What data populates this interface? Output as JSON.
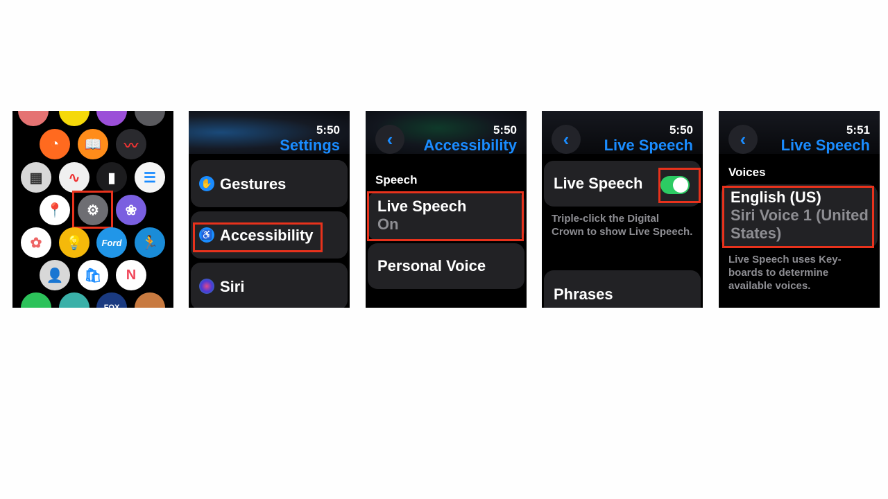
{
  "panel1": {
    "apps": [
      {
        "name": "settings-app",
        "glyph": "⚙",
        "color": "#6e6e73"
      }
    ]
  },
  "panel2": {
    "time": "5:50",
    "title": "Settings",
    "items": [
      {
        "label": "Gestures",
        "icon": "gestures-icon",
        "color": "#1a8cff"
      },
      {
        "label": "Accessibility",
        "icon": "accessibility-icon",
        "color": "#1a8cff"
      },
      {
        "label": "Siri",
        "icon": "siri-icon",
        "color": "#8a3ad8"
      }
    ]
  },
  "panel3": {
    "time": "5:50",
    "title": "Accessibility",
    "back": "‹",
    "section": "Speech",
    "items": [
      {
        "label": "Live Speech",
        "value": "On"
      },
      {
        "label": "Personal Voice"
      }
    ]
  },
  "panel4": {
    "time": "5:50",
    "title": "Live Speech",
    "back": "‹",
    "toggle_label": "Live Speech",
    "toggle_on": true,
    "note": "Triple-click the Digital Crown to show Live Speech.",
    "phrases": "Phrases"
  },
  "panel5": {
    "time": "5:51",
    "title": "Live Speech",
    "back": "‹",
    "section": "Voices",
    "voice_language": "English (US)",
    "voice_name": "Siri Voice 1 (United States)",
    "note": "Live Speech uses Key-boards to determine available voices."
  },
  "colors": {
    "accent": "#1a8cff",
    "highlight": "#e8321c",
    "toggle": "#2ccb63"
  }
}
